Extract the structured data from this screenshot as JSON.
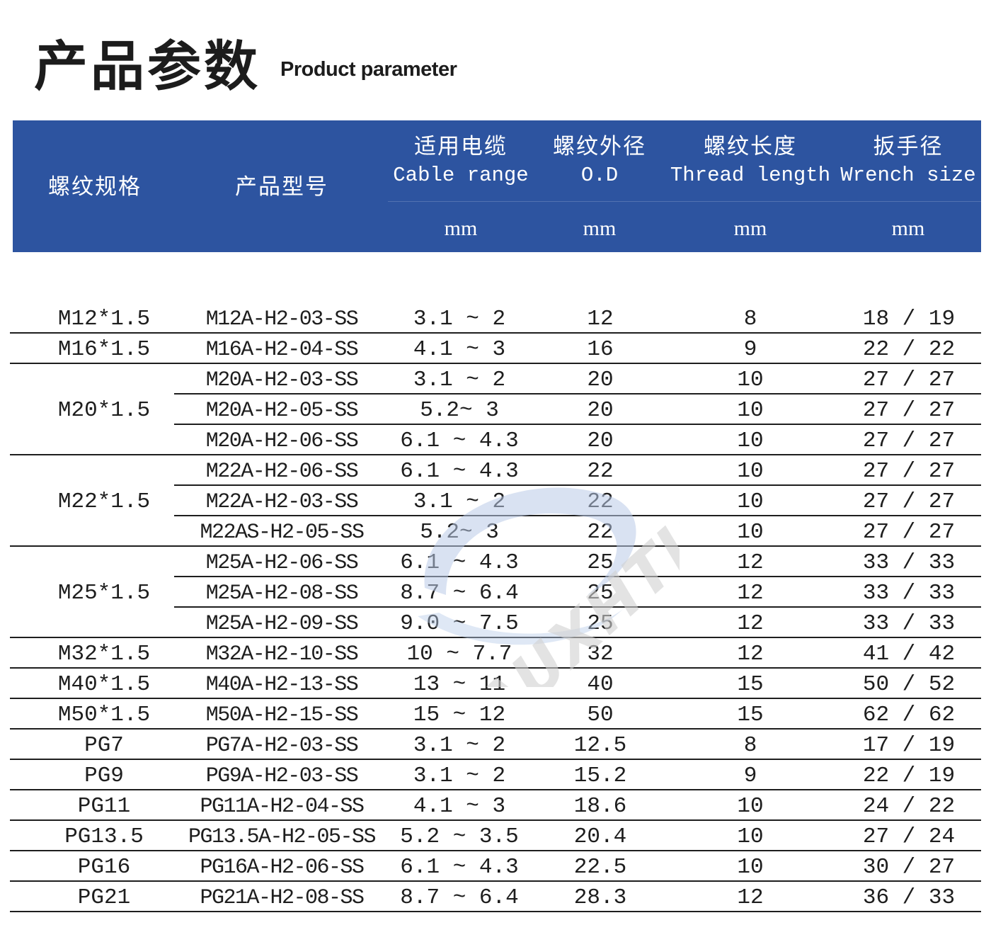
{
  "title": {
    "zh": "产品参数",
    "en": "Product parameter"
  },
  "header": {
    "spec": {
      "zh": "螺纹规格"
    },
    "model": {
      "zh": "产品型号"
    },
    "cable": {
      "zh": "适用电缆",
      "en": "Cable range",
      "unit": "mm"
    },
    "od": {
      "zh": "螺纹外径",
      "en": "O.D",
      "unit": "mm"
    },
    "tl": {
      "zh": "螺纹长度",
      "en": "Thread length",
      "unit": "mm"
    },
    "ws": {
      "zh": "扳手径",
      "en": "Wrench size",
      "unit": "mm"
    }
  },
  "groups": [
    {
      "spec": "M12*1.5",
      "rows": [
        {
          "model": "M12A-H2-03-SS",
          "cable": "3.1 ~ 2",
          "od": "12",
          "tl": "8",
          "ws": "18 / 19"
        }
      ]
    },
    {
      "spec": "M16*1.5",
      "rows": [
        {
          "model": "M16A-H2-04-SS",
          "cable": "4.1 ~ 3",
          "od": "16",
          "tl": "9",
          "ws": "22 / 22"
        }
      ]
    },
    {
      "spec": "M20*1.5",
      "rows": [
        {
          "model": "M20A-H2-03-SS",
          "cable": "3.1 ~ 2",
          "od": "20",
          "tl": "10",
          "ws": "27 / 27"
        },
        {
          "model": "M20A-H2-05-SS",
          "cable": "5.2~ 3",
          "od": "20",
          "tl": "10",
          "ws": "27 / 27"
        },
        {
          "model": "M20A-H2-06-SS",
          "cable": "6.1 ~ 4.3",
          "od": "20",
          "tl": "10",
          "ws": "27 / 27"
        }
      ]
    },
    {
      "spec": "M22*1.5",
      "rows": [
        {
          "model": "M22A-H2-06-SS",
          "cable": "6.1 ~ 4.3",
          "od": "22",
          "tl": "10",
          "ws": "27 / 27"
        },
        {
          "model": "M22A-H2-03-SS",
          "cable": "3.1 ~ 2",
          "od": "22",
          "tl": "10",
          "ws": "27 / 27"
        },
        {
          "model": "M22AS-H2-05-SS",
          "cable": "5.2~ 3",
          "od": "22",
          "tl": "10",
          "ws": "27 / 27"
        }
      ]
    },
    {
      "spec": "M25*1.5",
      "rows": [
        {
          "model": "M25A-H2-06-SS",
          "cable": "6.1 ~ 4.3",
          "od": "25",
          "tl": "12",
          "ws": "33 / 33"
        },
        {
          "model": "M25A-H2-08-SS",
          "cable": "8.7 ~ 6.4",
          "od": "25",
          "tl": "12",
          "ws": "33 / 33"
        },
        {
          "model": "M25A-H2-09-SS",
          "cable": "9.0 ~ 7.5",
          "od": "25",
          "tl": "12",
          "ws": "33 / 33"
        }
      ]
    },
    {
      "spec": "M32*1.5",
      "rows": [
        {
          "model": "M32A-H2-10-SS",
          "cable": "10 ~ 7.7",
          "od": "32",
          "tl": "12",
          "ws": "41 / 42"
        }
      ]
    },
    {
      "spec": "M40*1.5",
      "rows": [
        {
          "model": "M40A-H2-13-SS",
          "cable": "13 ~ 11",
          "od": "40",
          "tl": "15",
          "ws": "50 / 52"
        }
      ]
    },
    {
      "spec": "M50*1.5",
      "rows": [
        {
          "model": "M50A-H2-15-SS",
          "cable": "15 ~ 12",
          "od": "50",
          "tl": "15",
          "ws": "62 / 62"
        }
      ]
    },
    {
      "spec": "PG7",
      "rows": [
        {
          "model": "PG7A-H2-03-SS",
          "cable": "3.1 ~ 2",
          "od": "12.5",
          "tl": "8",
          "ws": "17 / 19"
        }
      ]
    },
    {
      "spec": "PG9",
      "rows": [
        {
          "model": "PG9A-H2-03-SS",
          "cable": "3.1 ~ 2",
          "od": "15.2",
          "tl": "9",
          "ws": "22 / 19"
        }
      ]
    },
    {
      "spec": "PG11",
      "rows": [
        {
          "model": "PG11A-H2-04-SS",
          "cable": "4.1 ~ 3",
          "od": "18.6",
          "tl": "10",
          "ws": "24 / 22"
        }
      ]
    },
    {
      "spec": "PG13.5",
      "rows": [
        {
          "model": "PG13.5A-H2-05-SS",
          "cable": "5.2 ~ 3.5",
          "od": "20.4",
          "tl": "10",
          "ws": "27 / 24"
        }
      ]
    },
    {
      "spec": "PG16",
      "rows": [
        {
          "model": "PG16A-H2-06-SS",
          "cable": "6.1 ~ 4.3",
          "od": "22.5",
          "tl": "10",
          "ws": "30 / 27"
        }
      ]
    },
    {
      "spec": "PG21",
      "rows": [
        {
          "model": "PG21A-H2-08-SS",
          "cable": "8.7 ~ 6.4",
          "od": "28.3",
          "tl": "12",
          "ws": "36 / 33"
        }
      ]
    }
  ],
  "watermark": {
    "text": "AUXHTION",
    "colors": {
      "text": "#d2d2d2",
      "swoosh": "#b9cbe8"
    }
  },
  "colors": {
    "header_bg": "#2d54a0",
    "header_text": "#ffffff",
    "text": "#1e1e1e"
  }
}
